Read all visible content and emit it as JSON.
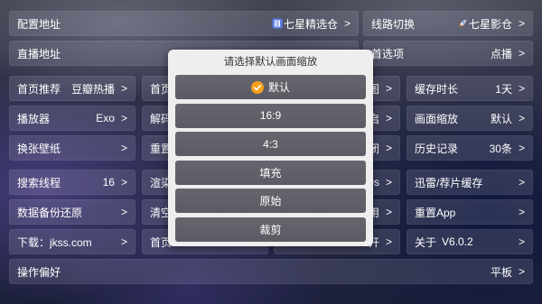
{
  "theme": {
    "accent": "#f5a11c",
    "dialog_bg": "#eeeeee",
    "option_bg": "#5e5e66"
  },
  "ui": {
    "chevron": ">"
  },
  "settings": {
    "config_url": {
      "label": "配置地址",
      "value": "七星精选仓",
      "icon": "app-badge-icon"
    },
    "source_switch": {
      "label": "线路切换",
      "value": "七星影仓",
      "icon": "rocket-icon"
    },
    "live_url": {
      "label": "直播地址"
    },
    "preference": {
      "label": "首选项",
      "value": "点播"
    },
    "home_recommend": {
      "label": "首页推荐",
      "value": "豆瓣热播"
    },
    "home_option": {
      "label": "首页"
    },
    "r3_col3": {
      "value": "图"
    },
    "cache_duration": {
      "label": "缓存时长",
      "value": "1天"
    },
    "player": {
      "label": "播放器",
      "value": "Exo"
    },
    "decode": {
      "label": "解码"
    },
    "r4_col3": {
      "value": "启"
    },
    "picture_scale": {
      "label": "画面缩放",
      "value": "默认"
    },
    "wallpaper": {
      "label": "换张壁纸"
    },
    "reset_option": {
      "label": "重置"
    },
    "r5_col3": {
      "value": "闭"
    },
    "history": {
      "label": "历史记录",
      "value": "30条"
    },
    "search_threads": {
      "label": "搜索线程",
      "value": "16"
    },
    "render": {
      "label": "渲染"
    },
    "r6_col3": {
      "value": "0s"
    },
    "thunder_cache": {
      "label": "迅雷/荐片缓存"
    },
    "backup": {
      "label": "数据备份还原"
    },
    "clear_option": {
      "label": "清空"
    },
    "r7_col3": {
      "value": "用"
    },
    "reset_app": {
      "label": "重置App"
    },
    "download": {
      "label": "下载：jkss.com"
    },
    "home_option_2": {
      "label": "首页"
    },
    "r8_col3": {
      "value": "开"
    },
    "about": {
      "label": "关于",
      "version": "V6.0.2"
    },
    "operation_pref": {
      "label": "操作偏好",
      "value": "平板"
    }
  },
  "dialog": {
    "title": "请选择默认画面缩放",
    "options": [
      "默认",
      "16:9",
      "4:3",
      "填充",
      "原始",
      "裁剪"
    ],
    "selected_index": 0,
    "selected_icon": "check-circle-icon"
  }
}
